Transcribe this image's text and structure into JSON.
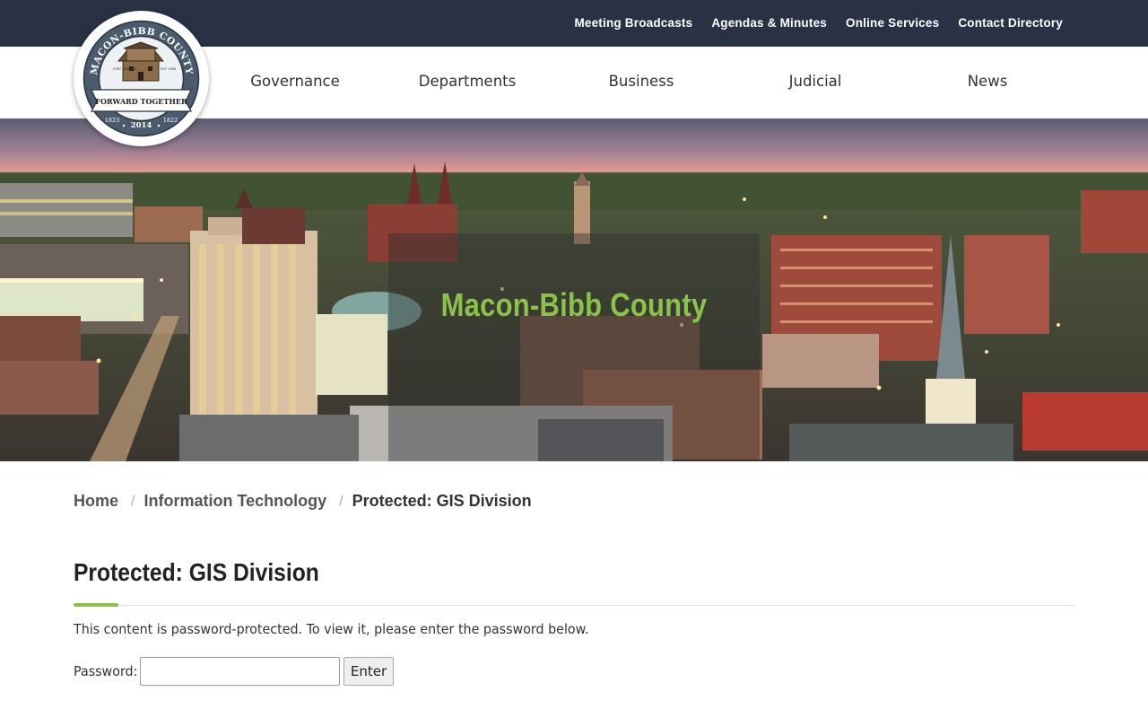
{
  "utility_nav": [
    "Meeting Broadcasts",
    "Agendas & Minutes",
    "Online Services",
    "Contact Directory"
  ],
  "main_nav": [
    "Governance",
    "Departments",
    "Business",
    "Judicial",
    "News"
  ],
  "logo": {
    "top_text": "MACON-BIBB COUNTY",
    "motto": "FORWARD TOGETHER",
    "year": "2014",
    "left_year": "1823",
    "right_year": "1822",
    "fort_left": "FORT HAWKINS",
    "fort_right": "EST. 1806"
  },
  "hero": {
    "title": "Macon-Bibb County"
  },
  "breadcrumb": {
    "home": "Home",
    "parent": "Information Technology",
    "current": "Protected: GIS Division",
    "separator": "/"
  },
  "page": {
    "title": "Protected: GIS Division",
    "intro": "This content is password-protected. To view it, please enter the password below.",
    "password_label": "Password:",
    "password_value": "",
    "submit_label": "Enter"
  },
  "colors": {
    "topbar": "#293145",
    "accent_green": "#8bc34a",
    "text_dark": "#222222"
  }
}
